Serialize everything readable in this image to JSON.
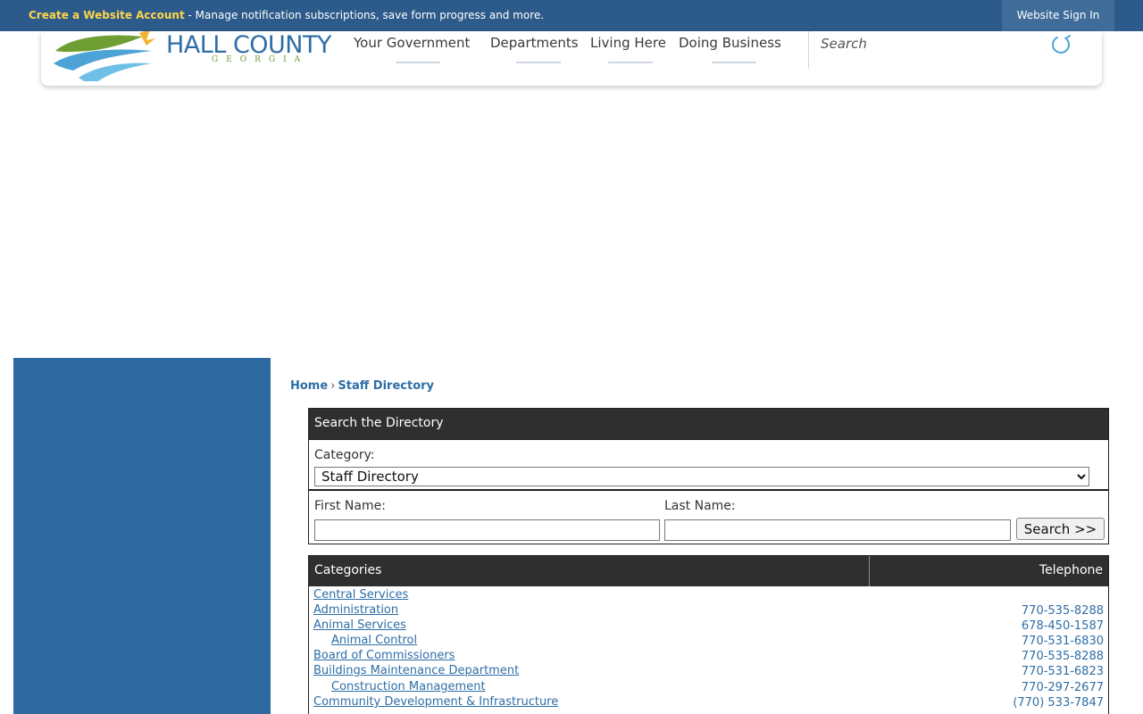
{
  "topbar": {
    "create_link": "Create a Website Account",
    "message": " - Manage notification subscriptions, save form progress and more.",
    "signin": "Website Sign In"
  },
  "logo": {
    "line1": "HALL COUNTY",
    "line2": "GEORGIA"
  },
  "nav": [
    {
      "label": "Your Government"
    },
    {
      "label": "Departments"
    },
    {
      "label": "Living Here"
    },
    {
      "label": "Doing Business"
    }
  ],
  "search": {
    "placeholder": "Search",
    "icon": "search-icon"
  },
  "breadcrumb": {
    "home": "Home",
    "sep": "›",
    "current": "Staff Directory"
  },
  "directory": {
    "heading": "Search the Directory",
    "category_label": "Category:",
    "category_value": "Staff Directory",
    "first_name_label": "First Name:",
    "last_name_label": "Last Name:",
    "search_button": "Search >>"
  },
  "categories": {
    "col1": "Categories",
    "col2": "Telephone",
    "rows": [
      {
        "name": "Central Services",
        "phone": "",
        "sub": false
      },
      {
        "name": "Administration",
        "phone": "770-535-8288",
        "sub": false
      },
      {
        "name": "Animal Services",
        "phone": "678-450-1587",
        "sub": false
      },
      {
        "name": "Animal Control",
        "phone": "770-531-6830",
        "sub": true
      },
      {
        "name": "Board of Commissioners",
        "phone": "770-535-8288",
        "sub": false
      },
      {
        "name": "Buildings Maintenance Department",
        "phone": "770-531-6823",
        "sub": false
      },
      {
        "name": "Construction Management",
        "phone": "770-297-2677",
        "sub": true
      },
      {
        "name": "Community Development & Infrastructure",
        "phone": "(770) 533-7847",
        "sub": false
      }
    ]
  },
  "colors": {
    "topbar": "#2c5a8a",
    "link": "#2e6ea6",
    "sidebar": "#2e6aa1",
    "table_head": "#2f2f2f"
  }
}
